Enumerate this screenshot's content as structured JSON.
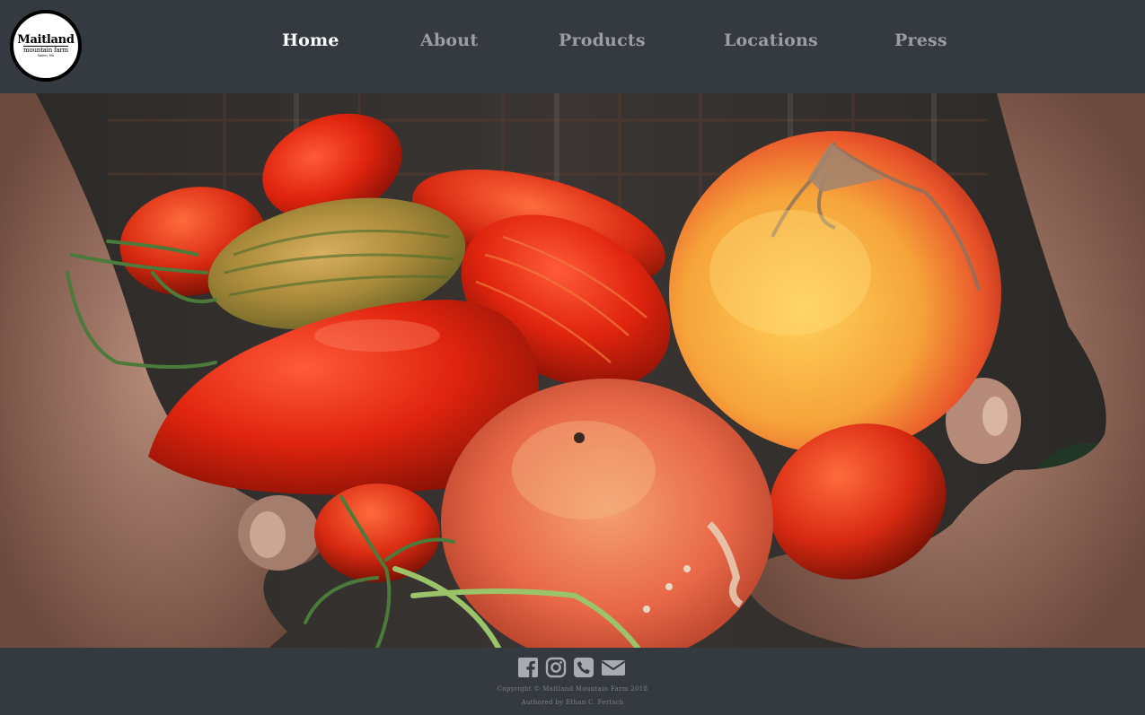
{
  "logo": {
    "line1": "Maitland",
    "line2": "mountain farm",
    "line3": "Salem, MA"
  },
  "nav": {
    "items": [
      {
        "label": "Home",
        "active": true
      },
      {
        "label": "About",
        "active": false
      },
      {
        "label": "Products",
        "active": false
      },
      {
        "label": "Locations",
        "active": false
      },
      {
        "label": "Press",
        "active": false
      }
    ]
  },
  "hero": {
    "subject": "heirloom-tomatoes-in-hands"
  },
  "footer": {
    "social": [
      {
        "icon": "facebook-icon"
      },
      {
        "icon": "instagram-icon"
      },
      {
        "icon": "phone-icon"
      },
      {
        "icon": "email-icon"
      }
    ],
    "copyright": "Copyright © Maitland Mountain Farm 2018",
    "authored": "Authored by Ethan C. Fertsch"
  },
  "colors": {
    "bar": "#343a40",
    "nav_active": "#ffffff",
    "nav_inactive": "#9a9ea3",
    "icon": "#a8acb1"
  }
}
